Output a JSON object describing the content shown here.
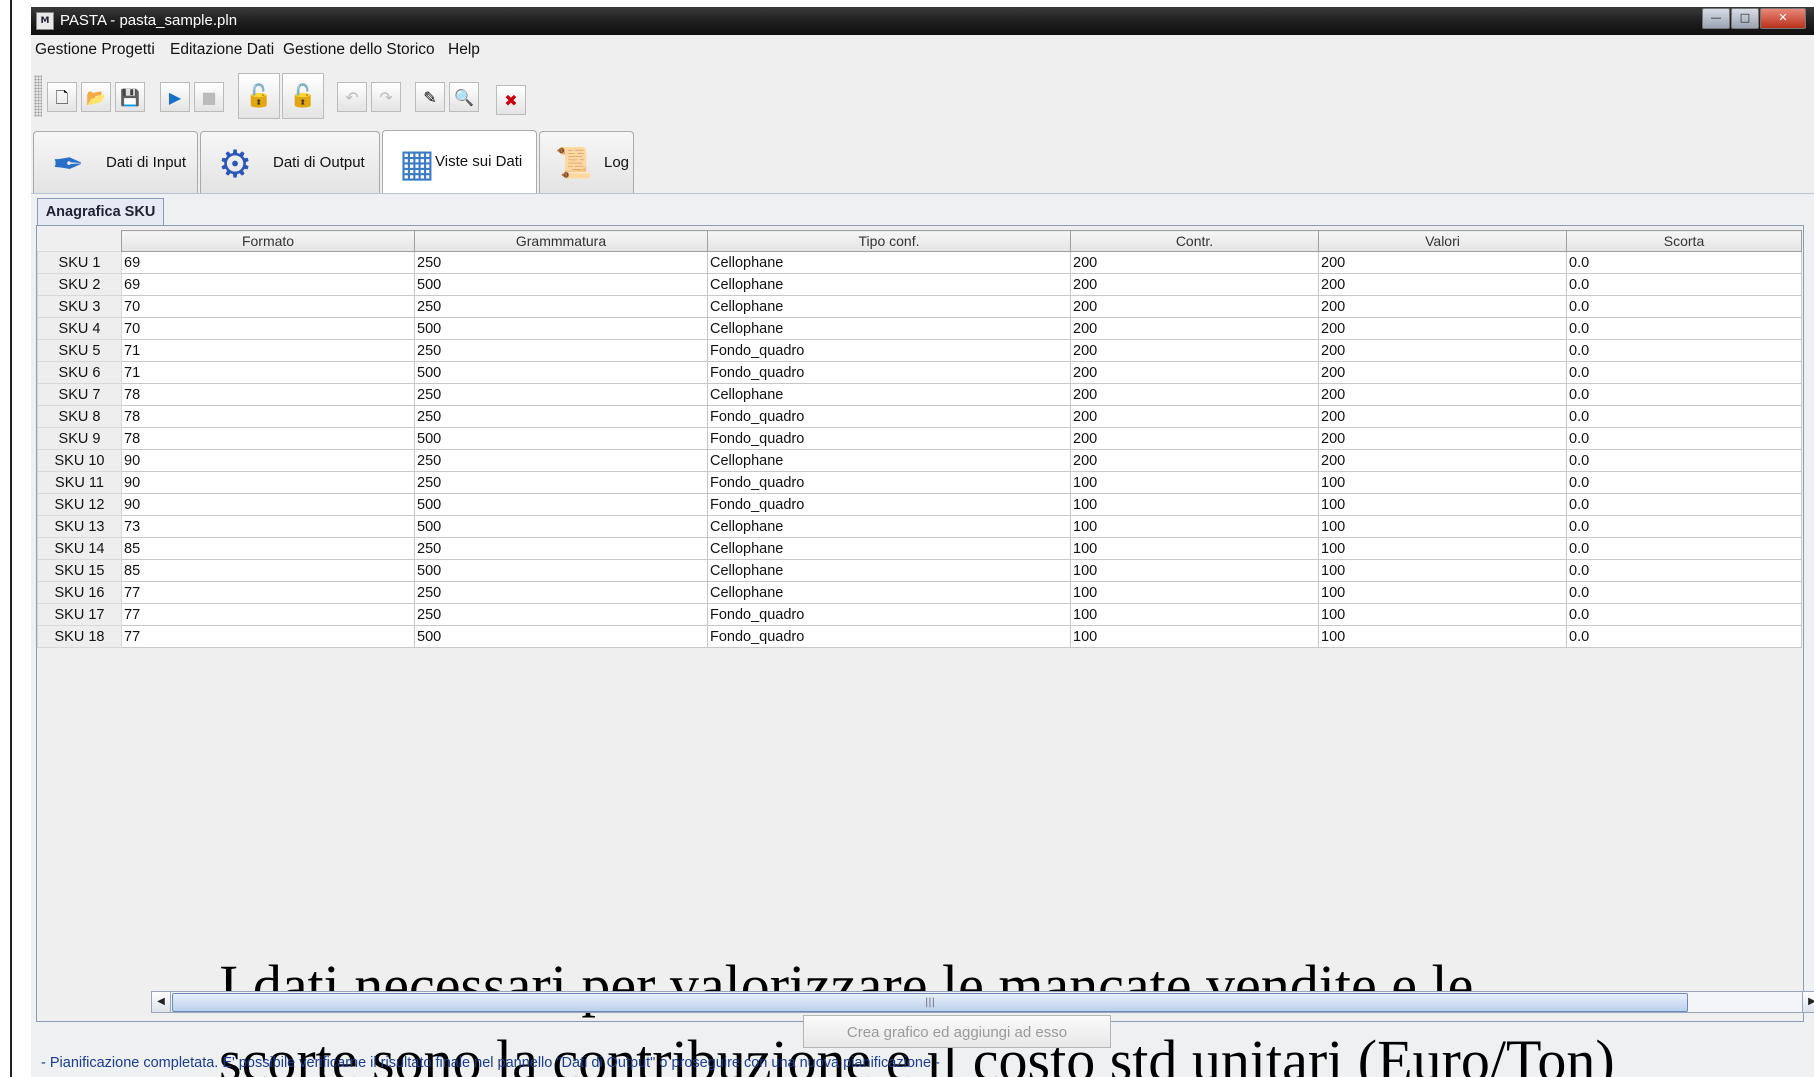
{
  "window": {
    "title": "PASTA - pasta_sample.pln",
    "app_icon": "M"
  },
  "menu": [
    "Gestione Progetti",
    "Editazione Dati",
    "Gestione dello Storico",
    "Help"
  ],
  "main_tabs": [
    "Dati di Input",
    "Dati di Output",
    "Viste sui Dati",
    "Log"
  ],
  "active_tab": "Viste sui Dati",
  "sub_tab": "Anagrafica SKU",
  "table": {
    "columns": [
      "Formato",
      "Grammmatura",
      "Tipo conf.",
      "Contr.",
      "Valori",
      "Scorta"
    ],
    "rows": [
      [
        "SKU 1",
        "69",
        "250",
        "Cellophane",
        "200",
        "200",
        "0.0"
      ],
      [
        "SKU 2",
        "69",
        "500",
        "Cellophane",
        "200",
        "200",
        "0.0"
      ],
      [
        "SKU 3",
        "70",
        "250",
        "Cellophane",
        "200",
        "200",
        "0.0"
      ],
      [
        "SKU 4",
        "70",
        "500",
        "Cellophane",
        "200",
        "200",
        "0.0"
      ],
      [
        "SKU 5",
        "71",
        "250",
        "Fondo_quadro",
        "200",
        "200",
        "0.0"
      ],
      [
        "SKU 6",
        "71",
        "500",
        "Fondo_quadro",
        "200",
        "200",
        "0.0"
      ],
      [
        "SKU 7",
        "78",
        "250",
        "Cellophane",
        "200",
        "200",
        "0.0"
      ],
      [
        "SKU 8",
        "78",
        "250",
        "Fondo_quadro",
        "200",
        "200",
        "0.0"
      ],
      [
        "SKU 9",
        "78",
        "500",
        "Fondo_quadro",
        "200",
        "200",
        "0.0"
      ],
      [
        "SKU 10",
        "90",
        "250",
        "Cellophane",
        "200",
        "200",
        "0.0"
      ],
      [
        "SKU 11",
        "90",
        "250",
        "Fondo_quadro",
        "100",
        "100",
        "0.0"
      ],
      [
        "SKU 12",
        "90",
        "500",
        "Fondo_quadro",
        "100",
        "100",
        "0.0"
      ],
      [
        "SKU 13",
        "73",
        "500",
        "Cellophane",
        "100",
        "100",
        "0.0"
      ],
      [
        "SKU 14",
        "85",
        "250",
        "Cellophane",
        "100",
        "100",
        "0.0"
      ],
      [
        "SKU 15",
        "85",
        "500",
        "Cellophane",
        "100",
        "100",
        "0.0"
      ],
      [
        "SKU 16",
        "77",
        "250",
        "Cellophane",
        "100",
        "100",
        "0.0"
      ],
      [
        "SKU 17",
        "77",
        "250",
        "Fondo_quadro",
        "100",
        "100",
        "0.0"
      ],
      [
        "SKU 18",
        "77",
        "500",
        "Fondo_quadro",
        "100",
        "100",
        "0.0"
      ]
    ]
  },
  "overlay_text": "I dati necessari per valorizzare le mancate vendite e le scorte sono la contribuzione e il costo std unitari (Euro/Ton)",
  "chart_button": "Crea grafico ed aggiungi ad esso",
  "status": "- Pianificazione completata. E' possibile verificarne il risultato finale nel pannello \"Dati di Output\" o proseguire con una nuova pianificazione -"
}
